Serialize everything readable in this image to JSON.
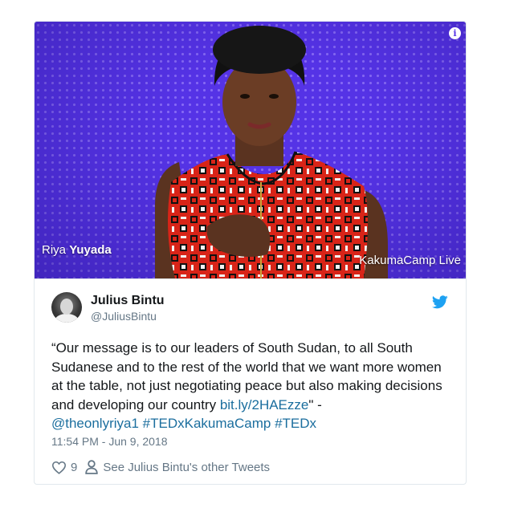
{
  "media": {
    "speaker_first": "Riya",
    "speaker_last": "Yuyada",
    "event_label": "KakumaCamp Live",
    "info_icon": "i"
  },
  "author": {
    "display_name": "Julius Bintu",
    "handle": "@JuliusBintu"
  },
  "tweet": {
    "text_part1": "“Our message is to our leaders of South Sudan, to all South Sudanese and to the rest of the world that we want more women at the table, not just negotiating peace but also making decisions and developing our country ",
    "link_url": "bit.ly/2HAEzze",
    "text_part2": "\" - ",
    "mention": "@theonlyriya1",
    "hashtag1": "#TEDxKakumaCamp",
    "hashtag2": "#TEDx",
    "timestamp": "11:54 PM - Jun 9, 2018"
  },
  "actions": {
    "like_count": "9",
    "other_tweets_label": "See Julius Bintu's other Tweets"
  },
  "colors": {
    "link": "#1b6e9e",
    "twitter_blue": "#1da1f2",
    "muted": "#657786",
    "background_purple": "#5533e6"
  },
  "icons": [
    "info-icon",
    "twitter-bird-icon",
    "heart-icon",
    "person-icon"
  ]
}
